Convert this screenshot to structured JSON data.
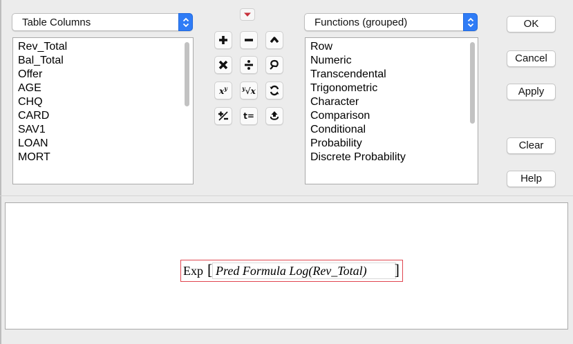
{
  "columns_select": {
    "value": "Table Columns"
  },
  "columns": [
    "Rev_Total",
    "Bal_Total",
    "Offer",
    "AGE",
    "CHQ",
    "CARD",
    "SAV1",
    "LOAN",
    "MORT"
  ],
  "functions_select": {
    "value": "Functions (grouped)"
  },
  "functions": [
    "Row",
    "Numeric",
    "Transcendental",
    "Trigonometric",
    "Character",
    "Comparison",
    "Conditional",
    "Probability",
    "Discrete Probability"
  ],
  "operators": {
    "row1": [
      "plus-icon",
      "minus-icon",
      "caret-up-icon"
    ],
    "row2": [
      "multiply-icon",
      "divide-icon",
      "lasso-icon"
    ],
    "row3": [
      "power-icon",
      "root-icon",
      "swap-icon"
    ],
    "row4": [
      "plus-minus-icon",
      "assign-icon",
      "peel-icon"
    ],
    "power_label": "x",
    "power_sup": "y",
    "root_label": "√x",
    "root_sup": "y",
    "assign_label": "t="
  },
  "buttons": {
    "ok": "OK",
    "cancel": "Cancel",
    "apply": "Apply",
    "clear": "Clear",
    "help": "Help"
  },
  "formula": {
    "function": "Exp",
    "argument": "Pred Formula Log(Rev_Total)"
  },
  "colors": {
    "accent": "#2f7cf6",
    "formula_border": "#e0454f",
    "menu_arrow": "#c8323c"
  }
}
